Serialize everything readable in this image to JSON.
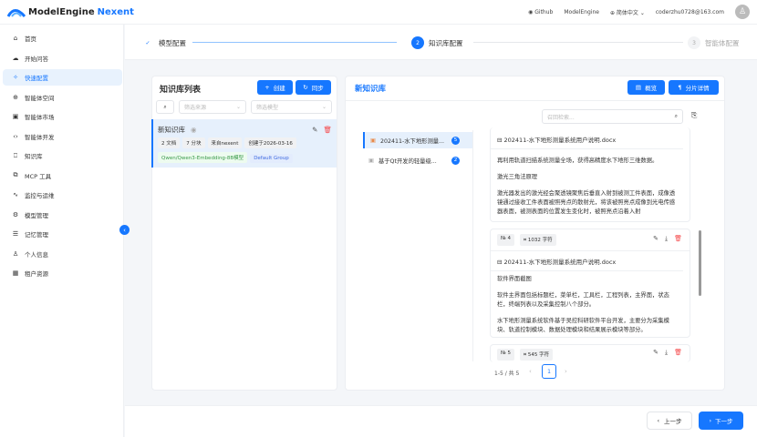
{
  "header": {
    "brand_main": "ModelEngine",
    "brand_accent": "Nexent",
    "links": [
      "Github",
      "ModelEngine"
    ],
    "language": "简体中文",
    "user_email": "coderzhu0728@163.com"
  },
  "sidebar": {
    "items": [
      {
        "label": "首页",
        "icon": "⌂"
      },
      {
        "label": "开始问答",
        "icon": "☁"
      },
      {
        "label": "快速配置",
        "icon": "✧"
      },
      {
        "label": "智能体空间",
        "icon": "⊕"
      },
      {
        "label": "智能体市场",
        "icon": "▣"
      },
      {
        "label": "智能体开发",
        "icon": "‹›"
      },
      {
        "label": "知识库",
        "icon": "⎕"
      },
      {
        "label": "MCP 工具",
        "icon": "⧉"
      },
      {
        "label": "监控与运维",
        "icon": "∿"
      },
      {
        "label": "模型管理",
        "icon": "⚙"
      },
      {
        "label": "记忆管理",
        "icon": "☰"
      },
      {
        "label": "个人信息",
        "icon": "♙"
      },
      {
        "label": "租户资源",
        "icon": "▦"
      }
    ],
    "active_index": 2
  },
  "steps": [
    {
      "num": "✓",
      "label": "模型配置",
      "state": "done"
    },
    {
      "num": "2",
      "label": "知识库配置",
      "state": "active"
    },
    {
      "num": "3",
      "label": "智能体配置",
      "state": "pending"
    }
  ],
  "kb_list": {
    "title": "知识库列表",
    "create_label": "创建",
    "sync_label": "同步",
    "filter_source": "筛选来源",
    "filter_model": "筛选模型",
    "items": [
      {
        "name": "新知识库",
        "tags": [
          "2 文档",
          "7 分块",
          "来自nexent",
          "创建于2026-03-16"
        ],
        "model": "Qwen/Qwen3-Embedding-8B模型",
        "group": "Default Group"
      }
    ]
  },
  "kb_detail": {
    "title": "新知识库",
    "overview_label": "概览",
    "chunks_label": "分片详情",
    "search_placeholder": "召回检索...",
    "docs": [
      {
        "name": "202411-水下地形测量...",
        "count": "5"
      },
      {
        "name": "基于Qt开发的轻量级...",
        "count": "2"
      }
    ],
    "chunks": [
      {
        "file": "202411-水下地形测量系统用户说明.docx",
        "paras": [
          "再利用轨道扫描系统测量全场，获得高精度水下地形三维数据。",
          "激光三角法原理",
          "激光器发出的激光经会聚透镜聚焦后垂直入射到被测工件表面，成像透镜通过接收工件表面被照亮点的散射光，将该被照亮点成像到光电传感器表面，被测表面的位置发生变化时，被照亮点沿着入射"
        ]
      },
      {
        "index": "4",
        "chars": "1032 字符",
        "file": "202411-水下地形测量系统用户说明.docx",
        "paras": [
          "软件界面截图",
          "软件主界面包括标题栏，菜单栏，工具栏，工程列表，主界面，状态栏，终端列表以及采集控制八个部分。",
          "水下地形测量系统软件基于吴控科研软件平台开发，主要分为采集模块、轨道控制模块、数据处理模块和结果展示模块等部分。"
        ]
      },
      {
        "index": "5",
        "chars": "545 字符"
      }
    ],
    "pagination": {
      "summary": "1-5 / 共 5",
      "current": "1"
    }
  },
  "footer": {
    "prev_label": "上一步",
    "next_label": "下一步"
  }
}
